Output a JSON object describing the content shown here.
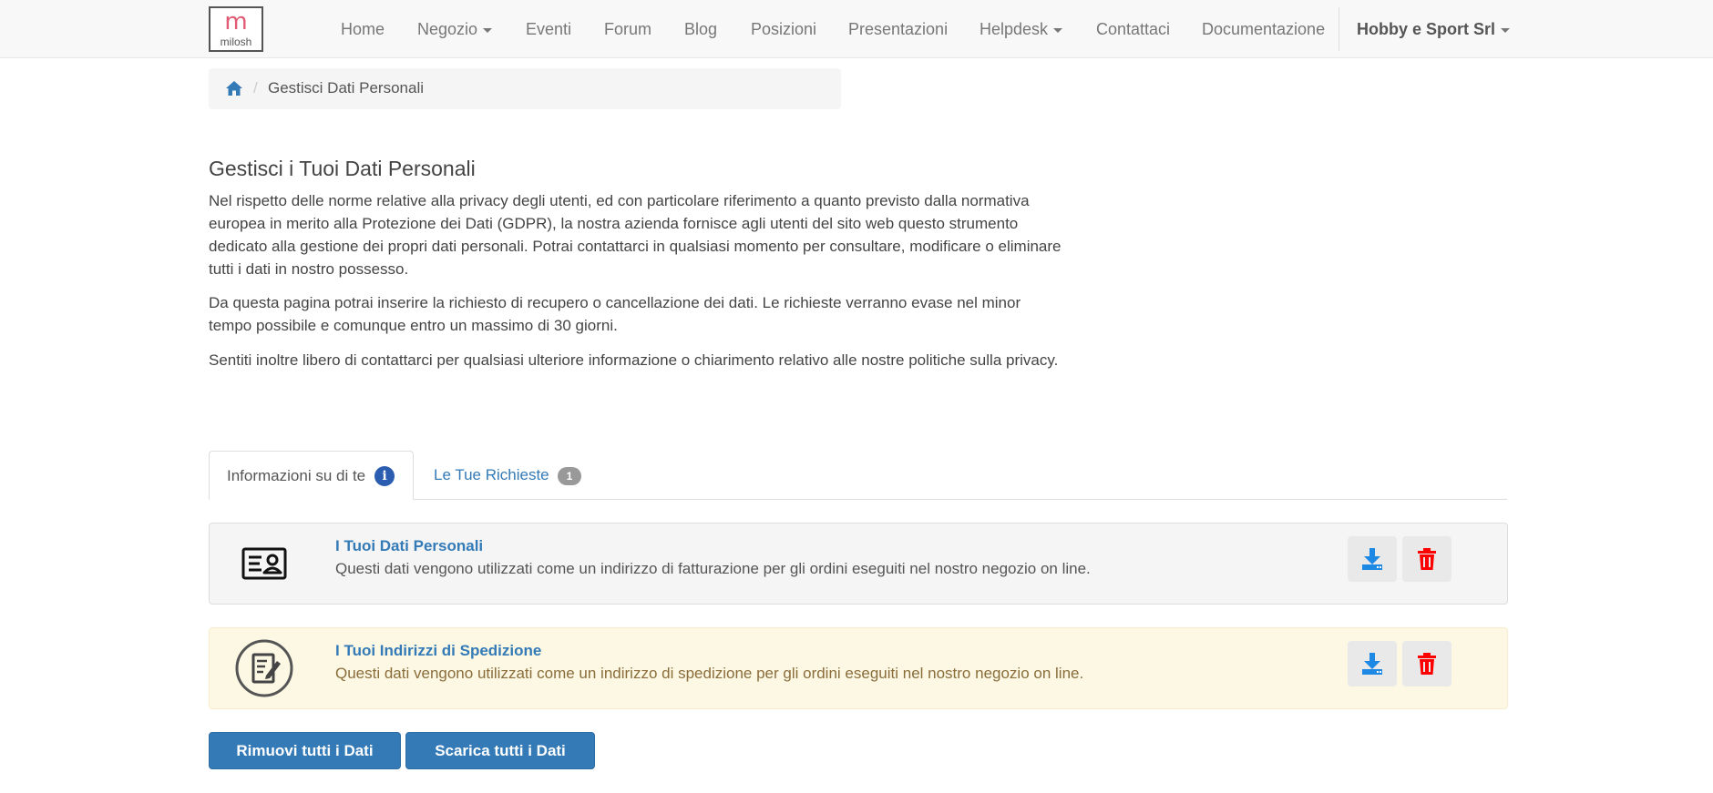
{
  "brand": {
    "logo_letter": "m",
    "logo_text": "milosh"
  },
  "nav": {
    "items": [
      {
        "label": "Home"
      },
      {
        "label": "Negozio"
      },
      {
        "label": "Eventi"
      },
      {
        "label": "Forum"
      },
      {
        "label": "Blog"
      },
      {
        "label": "Posizioni"
      },
      {
        "label": "Presentazioni"
      },
      {
        "label": "Helpdesk"
      },
      {
        "label": "Contattaci"
      },
      {
        "label": "Documentazione"
      }
    ],
    "company": "Hobby e Sport Srl"
  },
  "breadcrumb": {
    "current": "Gestisci Dati Personali"
  },
  "main": {
    "title": "Gestisci i Tuoi Dati Personali",
    "paragraphs": [
      "Nel rispetto delle norme relative alla privacy degli utenti, ed con particolare riferimento a quanto previsto dalla normativa europea in merito alla Protezione dei Dati (GDPR), la nostra azienda fornisce agli utenti del sito web questo strumento dedicato alla gestione dei propri dati personali. Potrai contattarci in qualsiasi momento per consultare, modificare o eliminare tutti i dati in nostro possesso.",
      "Da questa pagina potrai inserire la richiesto di recupero o cancellazione dei dati. Le richieste verranno evase nel minor tempo possibile e comunque entro un massimo di 30 giorni.",
      "Sentiti inoltre libero di contattarci per qualsiasi ulteriore informazione o chiarimento relativo alle nostre politiche sulla privacy."
    ]
  },
  "tabs": {
    "info_label": "Informazioni su di te",
    "requests_label": "Le Tue Richieste",
    "requests_count": "1"
  },
  "panels": [
    {
      "title": "I Tuoi Dati Personali",
      "description": "Questi dati vengono utilizzati come un indirizzo di fatturazione per gli ordini eseguiti nel nostro negozio on line.",
      "icon": "id-card-icon"
    },
    {
      "title": "I Tuoi Indirizzi di Spedizione",
      "description": "Questi dati vengono utilizzati come un indirizzo di spedizione per gli ordini eseguiti nel nostro negozio on line.",
      "icon": "document-edit-icon"
    }
  ],
  "actions": {
    "remove_all": "Rimuovi tutti i Dati",
    "download_all": "Scarica tutti i Dati"
  },
  "colors": {
    "link": "#337ab7",
    "download_icon": "#1e88e5",
    "delete_icon": "#ff0000",
    "warning_bg": "#fcf8e3"
  }
}
